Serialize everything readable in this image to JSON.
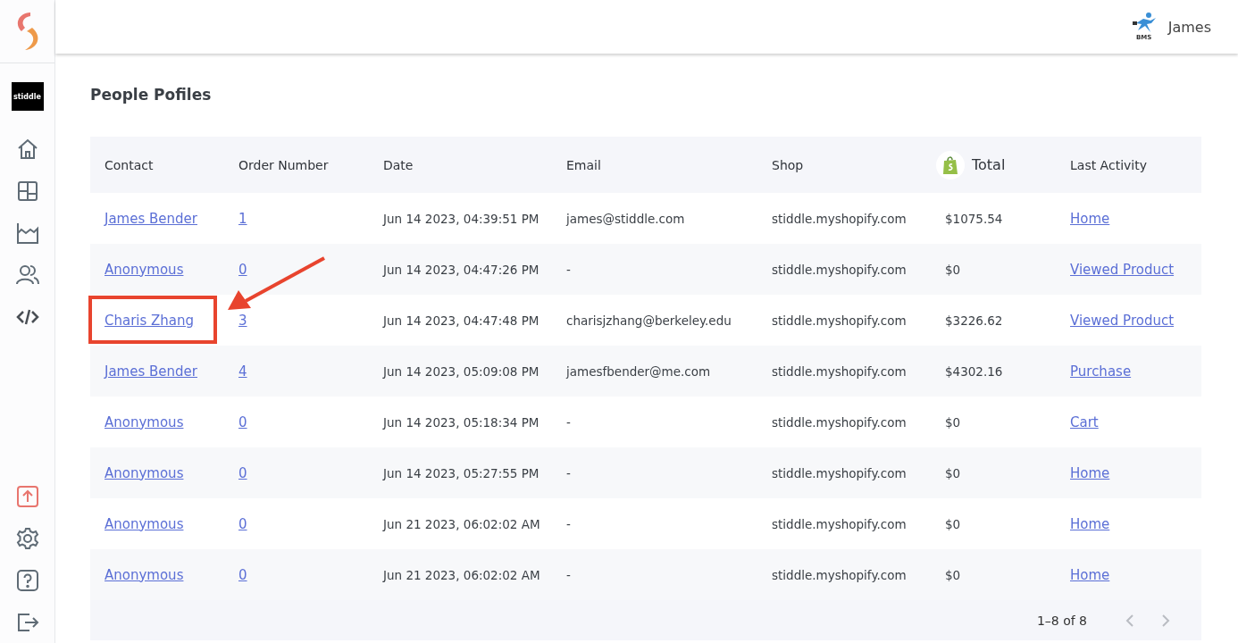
{
  "sidebar": {
    "workspace_logo": "stiddle",
    "items": [
      {
        "kind": "home",
        "selected": false
      },
      {
        "kind": "dashboard",
        "selected": false
      },
      {
        "kind": "chart",
        "selected": false
      },
      {
        "kind": "people",
        "selected": false
      },
      {
        "kind": "code",
        "selected": false
      }
    ],
    "bottom_items": [
      {
        "kind": "upload"
      },
      {
        "kind": "settings"
      },
      {
        "kind": "help"
      },
      {
        "kind": "logout"
      }
    ]
  },
  "header": {
    "logo_text": "BMS",
    "user_name": "James"
  },
  "page_title": "People Pofiles",
  "table": {
    "columns": [
      {
        "label": "Contact",
        "kind": "text"
      },
      {
        "label": "Order Number",
        "kind": "text"
      },
      {
        "label": "Date",
        "kind": "text"
      },
      {
        "label": "Email",
        "kind": "text"
      },
      {
        "label": "Shop",
        "kind": "text"
      },
      {
        "label": "Total",
        "kind": "shop-icon"
      },
      {
        "label": "Last Activity",
        "kind": "text"
      }
    ],
    "rows": [
      {
        "contact": "James Bender",
        "order": "1",
        "date": "Jun 14 2023, 04:39:51 PM",
        "email": "james@stiddle.com",
        "shop": "stiddle.myshopify.com",
        "total": "$1075.54",
        "last_activity": "Home",
        "highlighted": false
      },
      {
        "contact": "Anonymous",
        "order": "0",
        "date": "Jun 14 2023, 04:47:26 PM",
        "email": "-",
        "shop": "stiddle.myshopify.com",
        "total": "$0",
        "last_activity": "Viewed Product",
        "highlighted": false
      },
      {
        "contact": "Charis Zhang",
        "order": "3",
        "date": "Jun 14 2023, 04:47:48 PM",
        "email": "charisjzhang@berkeley.edu",
        "shop": "stiddle.myshopify.com",
        "total": "$3226.62",
        "last_activity": "Viewed Product",
        "highlighted": true
      },
      {
        "contact": "James Bender",
        "order": "4",
        "date": "Jun 14 2023, 05:09:08 PM",
        "email": "jamesfbender@me.com",
        "shop": "stiddle.myshopify.com",
        "total": "$4302.16",
        "last_activity": "Purchase",
        "highlighted": false
      },
      {
        "contact": "Anonymous",
        "order": "0",
        "date": "Jun 14 2023, 05:18:34 PM",
        "email": "-",
        "shop": "stiddle.myshopify.com",
        "total": "$0",
        "last_activity": "Cart",
        "highlighted": false
      },
      {
        "contact": "Anonymous",
        "order": "0",
        "date": "Jun 14 2023, 05:27:55 PM",
        "email": "-",
        "shop": "stiddle.myshopify.com",
        "total": "$0",
        "last_activity": "Home",
        "highlighted": false
      },
      {
        "contact": "Anonymous",
        "order": "0",
        "date": "Jun 21 2023, 06:02:02 AM",
        "email": "-",
        "shop": "stiddle.myshopify.com",
        "total": "$0",
        "last_activity": "Home",
        "highlighted": false
      },
      {
        "contact": "Anonymous",
        "order": "0",
        "date": "Jun 21 2023, 06:02:02 AM",
        "email": "-",
        "shop": "stiddle.myshopify.com",
        "total": "$0",
        "last_activity": "Home",
        "highlighted": false
      }
    ],
    "pagination": {
      "range": "1–8 of 8",
      "prev_disabled": true,
      "next_disabled": true
    }
  }
}
